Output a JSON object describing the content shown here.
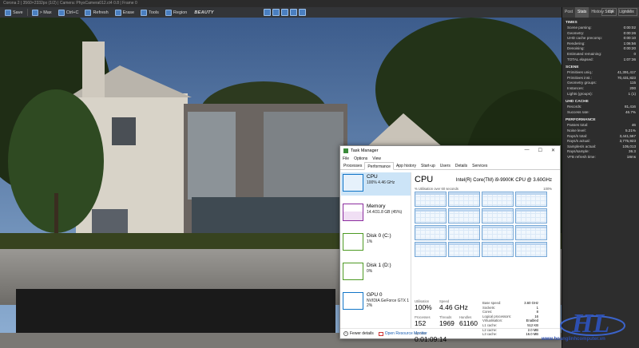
{
  "window": {
    "title": "Corona 2 | 3560×2332px (1/2) | Camera: PhysCamera012.ct4 0.8 | Frame 0"
  },
  "toolbar": {
    "save": "Save",
    "max": "> Max",
    "ctrl_c": "Ctrl+C",
    "refresh": "Refresh",
    "erase": "Erase",
    "tools": "Tools",
    "region": "Region",
    "pass": "BEAUTY"
  },
  "panel": {
    "tabs": [
      "Post",
      "Stats",
      "History",
      "DR",
      "LightMix"
    ],
    "stop": "Stop",
    "render": "Render",
    "sections": [
      {
        "title": "TIMES",
        "rows": [
          [
            "Scene parsing:",
            "0:00:02"
          ],
          [
            "Geometry:",
            "0:00:26"
          ],
          [
            "UHD cache precomp:",
            "0:00:10"
          ],
          [
            "Rendering:",
            "1:06:56"
          ],
          [
            "Denoising:",
            "0:00:20"
          ],
          [
            "Estimated remaining:",
            "0"
          ],
          [
            "TOTAL elapsed:",
            "1:07:36"
          ]
        ]
      },
      {
        "title": "SCENE",
        "rows": [
          [
            "Primitives uniq.:",
            "41,391,417"
          ],
          [
            "Primitives inst.:",
            "70,431,823"
          ],
          [
            "Geometry groups:",
            "115"
          ],
          [
            "Instances:",
            "200"
          ],
          [
            "Lights (groups):",
            "1 (1)"
          ]
        ]
      },
      {
        "title": "UHD CACHE",
        "rows": [
          [
            "Records:",
            "81,416"
          ],
          [
            "Success rate:",
            "46.7%"
          ]
        ]
      },
      {
        "title": "PERFORMANCE",
        "rows": [
          [
            "Passes total:",
            "46"
          ],
          [
            "Noise level:",
            "5.21%"
          ],
          [
            "Rays/s total:",
            "3,441,567"
          ],
          [
            "Rays/s actual:",
            "3,775,923"
          ],
          [
            "Samples/s actual:",
            "105,013"
          ],
          [
            "Rays/sample:",
            "36.3"
          ],
          [
            "VFB refresh time:",
            "18ms"
          ]
        ]
      }
    ]
  },
  "taskmanager": {
    "title": "Task Manager",
    "min": "—",
    "max": "☐",
    "close": "✕",
    "menu": [
      "File",
      "Options",
      "View"
    ],
    "tabs": [
      "Processes",
      "Performance",
      "App history",
      "Start-up",
      "Users",
      "Details",
      "Services"
    ],
    "resources": [
      {
        "name": "CPU",
        "sub": "100% 4.46 GHz",
        "color": "#1175c8"
      },
      {
        "name": "Memory",
        "sub": "14.4/31.8 GB (45%)",
        "color": "#8b2d9e"
      },
      {
        "name": "Disk 0 (C:)",
        "sub": "1%",
        "color": "#4d9a23"
      },
      {
        "name": "Disk 1 (D:)",
        "sub": "0%",
        "color": "#4d9a23"
      },
      {
        "name": "GPU 0",
        "sub": "NVIDIA GeForce GTX 10",
        "sub2": "2%",
        "color": "#1175c8"
      }
    ],
    "cpu": {
      "title": "CPU",
      "model": "Intel(R) Core(TM) i9-9900K CPU @ 3.60GHz",
      "util_caption": "% Utilisation over 60 seconds",
      "util_max": "100%",
      "core_load": [
        1,
        1,
        1,
        1,
        1,
        1,
        1,
        1,
        1,
        1,
        1,
        1,
        1,
        1,
        1,
        1
      ],
      "utilisation_label": "Utilisation",
      "utilisation": "100%",
      "speed_label": "Speed",
      "speed": "4.46 GHz",
      "processes_label": "Processes",
      "processes": "152",
      "threads_label": "Threads",
      "threads": "1969",
      "handles_label": "Handles",
      "handles": "61160",
      "uptime_label": "Up time",
      "uptime": "0:01:09:14",
      "details": [
        [
          "Base speed:",
          "3.60 GHz"
        ],
        [
          "Sockets:",
          "1"
        ],
        [
          "Cores:",
          "8"
        ],
        [
          "Logical processors:",
          "16"
        ],
        [
          "Virtualisation:",
          "Enabled"
        ],
        [
          "L1 cache:",
          "512 KB"
        ],
        [
          "L2 cache:",
          "2.0 MB"
        ],
        [
          "L3 cache:",
          "16.0 MB"
        ]
      ]
    },
    "footer": {
      "fewer": "Fewer details",
      "orm": "Open Resource Monitor"
    }
  },
  "watermark": {
    "logo": "HL",
    "url": "www.hoanglinhcomputer.vn"
  }
}
